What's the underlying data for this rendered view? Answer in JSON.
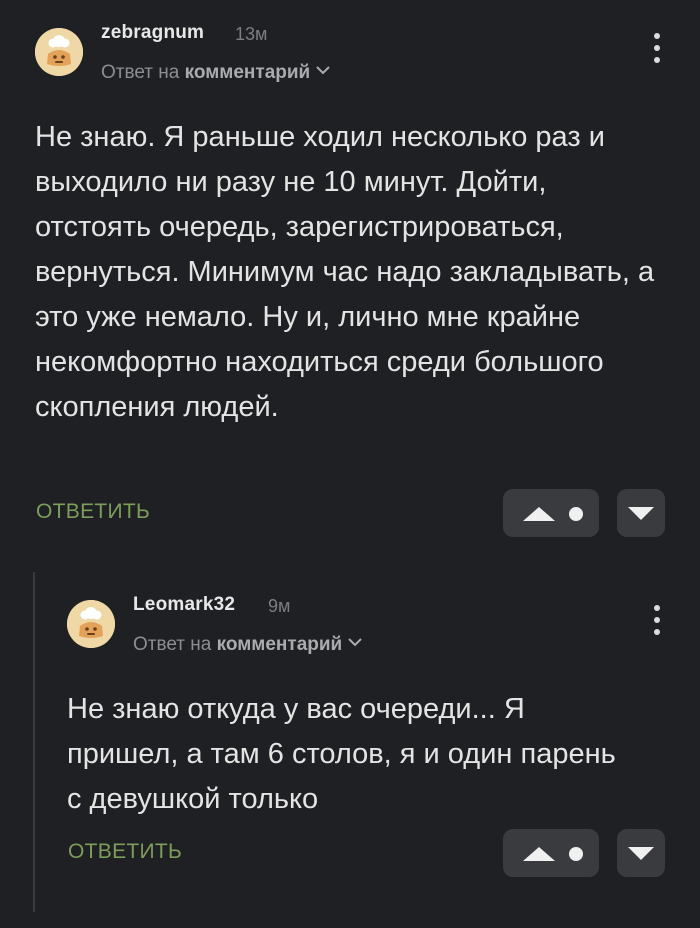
{
  "comments": [
    {
      "username": "zebragnum",
      "time": "13м",
      "reply_prefix": "Ответ на ",
      "reply_target": "комментарий",
      "text": "Не знаю. Я раньше ходил несколько раз и выходило ни разу не 10 минут. Дойти, отстоять очередь, зарегистрироваться, вернуться. Минимум час надо закладывать, а это уже немало. Ну и, лично мне крайне некомфортно находиться среди большого скопления людей.",
      "reply_label": "ОТВЕТИТЬ"
    },
    {
      "username": "Leomark32",
      "time": "9м",
      "reply_prefix": "Ответ на ",
      "reply_target": "комментарий",
      "text": "Не знаю откуда у вас очереди... Я пришел, а там 6 столов, я и один парень с девушкой только",
      "reply_label": "ОТВЕТИТЬ"
    }
  ],
  "icons": {
    "avatar": "default-avatar-icon",
    "more": "more-vertical-icon",
    "expand": "chevron-down-icon",
    "upvote": "upvote-arrow-icon",
    "rating": "rating-dot-icon",
    "downvote": "downvote-arrow-icon"
  },
  "colors": {
    "background": "#1f2023",
    "reply_action": "#7d9d5a",
    "vote_button": "#3a3b3f",
    "avatar_bg": "#efd8a5"
  }
}
